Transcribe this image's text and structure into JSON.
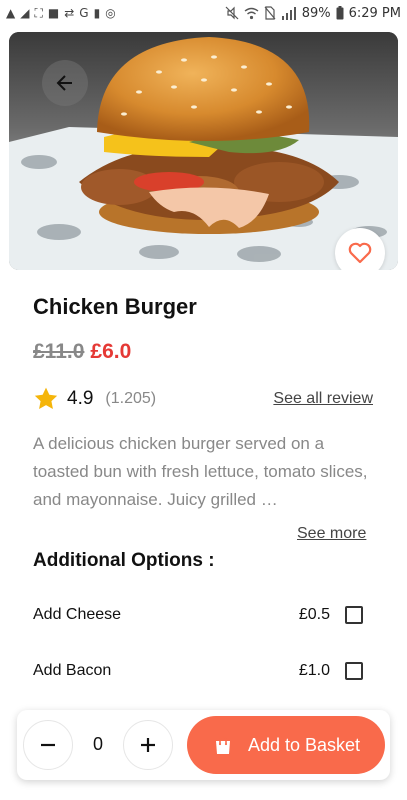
{
  "status_bar": {
    "left_icons": [
      "warning-icon",
      "telegram-icon",
      "screenshot-icon",
      "puzzle-icon",
      "usb-icon",
      "google-icon",
      "lock-icon",
      "vpn-icon"
    ],
    "left_glyphs": [
      "▲",
      "◢",
      "⛶",
      "■",
      "⇄",
      "G",
      "▮",
      "◎"
    ],
    "battery": "89%",
    "time": "6:29 PM"
  },
  "product": {
    "title": "Chicken Burger",
    "old_price": "£11.0",
    "new_price": "£6.0",
    "rating": "4.9",
    "rating_count": "(1.205)",
    "see_all_label": "See all review",
    "description": "A delicious chicken burger served on a toasted bun with fresh lettuce, tomato slices, and mayonnaise. Juicy grilled …",
    "see_more_label": "See more"
  },
  "options": {
    "title": "Additional Options :",
    "items": [
      {
        "name": "Add Cheese",
        "price": "£0.5",
        "checked": false
      },
      {
        "name": "Add Bacon",
        "price": "£1.0",
        "checked": false
      }
    ]
  },
  "cart": {
    "quantity": "0",
    "add_label": "Add to Basket"
  },
  "colors": {
    "accent": "#f96a4b",
    "sale_price": "#e53935",
    "star": "#f5b50a",
    "heart": "#f96a4b"
  }
}
